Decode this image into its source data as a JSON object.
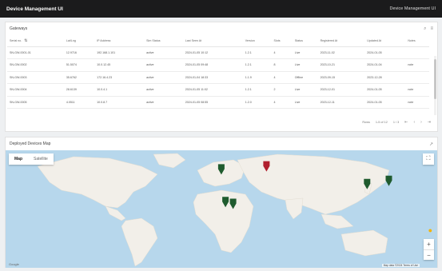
{
  "app": {
    "title": "Device Management UI",
    "right_label": "Device Management UI"
  },
  "table_card": {
    "title": "Gateways",
    "icons": [
      "search-icon",
      "filter-icon"
    ],
    "columns": [
      "Serial no.",
      "Lat/Lng",
      "IP Address",
      "Sim Status",
      "Last Seen At",
      "Version",
      "Slots",
      "Status",
      "Registered At",
      "Updated At",
      "Notes"
    ],
    "rows": [
      [
        "SN-GW-0001-01",
        "12.9716",
        "192.168.1.101",
        "active",
        "2024-01-05 10:12",
        "1.2.1",
        "4",
        "Live",
        "2023-11-02",
        "2024-01-05",
        ""
      ],
      [
        "SN-GW-0002",
        "51.5074",
        "10.0.12.45",
        "active",
        "2024-01-05 09:48",
        "1.2.1",
        "8",
        "Live",
        "2023-10-21",
        "2024-01-04",
        "note"
      ],
      [
        "SN-GW-0003",
        "35.6762",
        "172.16.4.23",
        "active",
        "2024-01-04 18:33",
        "1.1.9",
        "4",
        "Offline",
        "2023-09-15",
        "2023-12-28",
        ""
      ],
      [
        "SN-GW-0004",
        "28.6139",
        "10.0.4.1",
        "active",
        "2024-01-05 11:02",
        "1.2.1",
        "2",
        "Live",
        "2023-12-01",
        "2024-01-05",
        "note"
      ],
      [
        "SN-GW-0005",
        "4.0511",
        "10.0.8.7",
        "active",
        "2024-01-05 08:55",
        "1.2.0",
        "4",
        "Live",
        "2023-12-11",
        "2024-01-05",
        "note"
      ]
    ],
    "pager": {
      "rows_label": "Rows",
      "range": "1-5 of 12",
      "page": "1 / 3"
    }
  },
  "map_card": {
    "title": "Deployed Devices Map",
    "toggle": [
      "Map",
      "Satellite"
    ],
    "google_label": "Google",
    "attribution": "Map data ©2024 Terms of Use",
    "pins": [
      {
        "color": "#1f5b2e",
        "lat": 51.5,
        "lng": -0.1
      },
      {
        "color": "#b01f2e",
        "lat": 55.75,
        "lng": 37.6
      },
      {
        "color": "#1f5b2e",
        "lat": 35.7,
        "lng": 139.7
      },
      {
        "color": "#1f5b2e",
        "lat": 31.2,
        "lng": 121.5
      },
      {
        "color": "#1f5b2e",
        "lat": 4.05,
        "lng": 9.7
      },
      {
        "color": "#1f5b2e",
        "lat": 6.5,
        "lng": 3.4
      }
    ]
  }
}
